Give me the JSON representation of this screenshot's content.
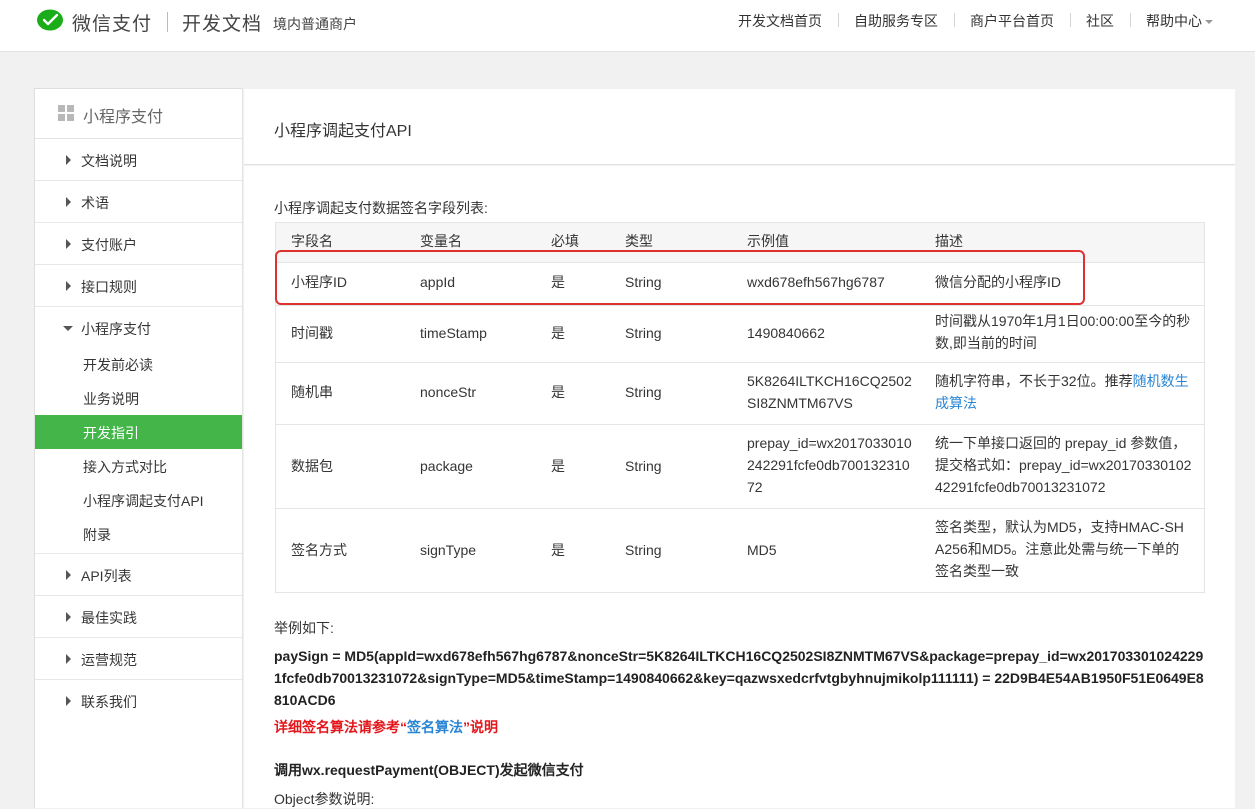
{
  "header": {
    "brand": "微信支付",
    "brand2": "开发文档",
    "brand_sub": "境内普通商户",
    "nav": [
      "开发文档首页",
      "自助服务专区",
      "商户平台首页",
      "社区",
      "帮助中心"
    ]
  },
  "sidebar": {
    "title": "小程序支付",
    "items_top": [
      "文档说明",
      "术语",
      "支付账户",
      "接口规则"
    ],
    "expanded": "小程序支付",
    "subitems": [
      "开发前必读",
      "业务说明",
      "开发指引",
      "接入方式对比",
      "小程序调起支付API",
      "附录"
    ],
    "active_subitem": "开发指引",
    "items_bottom": [
      "API列表",
      "最佳实践",
      "运营规范",
      "联系我们"
    ]
  },
  "main": {
    "title": "小程序调起支付API",
    "table_caption": "小程序调起支付数据签名字段列表:",
    "columns": [
      "字段名",
      "变量名",
      "必填",
      "类型",
      "示例值",
      "描述"
    ],
    "rows": [
      {
        "field": "小程序ID",
        "var": "appId",
        "required": "是",
        "type": "String",
        "example": "wxd678efh567hg6787",
        "desc": "微信分配的小程序ID"
      },
      {
        "field": "时间戳",
        "var": "timeStamp",
        "required": "是",
        "type": "String",
        "example": "1490840662",
        "desc": "时间戳从1970年1月1日00:00:00至今的秒数,即当前的时间"
      },
      {
        "field": "随机串",
        "var": "nonceStr",
        "required": "是",
        "type": "String",
        "example": "5K8264ILTKCH16CQ2502SI8ZNMTM67VS",
        "desc": "随机字符串，不长于32位。推荐",
        "desc_link": "随机数生成算法"
      },
      {
        "field": "数据包",
        "var": "package",
        "required": "是",
        "type": "String",
        "example": "prepay_id=wx2017033010242291fcfe0db70013231072",
        "desc": "统一下单接口返回的 prepay_id 参数值，提交格式如：prepay_id=wx2017033010242291fcfe0db70013231072"
      },
      {
        "field": "签名方式",
        "var": "signType",
        "required": "是",
        "type": "String",
        "example": "MD5",
        "desc": "签名类型，默认为MD5，支持HMAC-SHA256和MD5。注意此处需与统一下单的签名类型一致"
      }
    ],
    "example_label": "举例如下:",
    "example_code": "paySign = MD5(appId=wxd678efh567hg6787&nonceStr=5K8264ILTKCH16CQ2502SI8ZNMTM67VS&package=prepay_id=wx2017033010242291fcfe0db70013231072&signType=MD5&timeStamp=1490840662&key=qazwsxedcrfvtgbyhnujmikolp111111) = 22D9B4E54AB1950F51E0649E8810ACD6",
    "note_prefix": "详细签名算法请参考“",
    "note_link": "签名算法",
    "note_suffix": "”说明",
    "section_title": "调用wx.requestPayment(OBJECT)发起微信支付",
    "object_label": "Object参数说明:"
  },
  "colors": {
    "accent_green": "#44b549",
    "link": "#2a86d4",
    "highlight_red": "#e03131"
  }
}
